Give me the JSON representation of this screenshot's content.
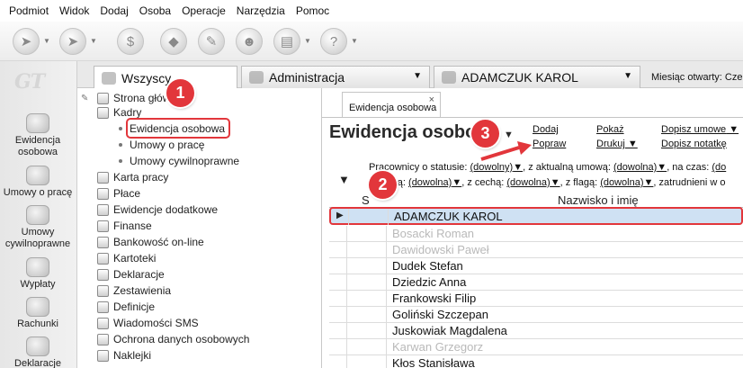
{
  "menu": [
    "Podmiot",
    "Widok",
    "Dodaj",
    "Osoba",
    "Operacje",
    "Narzędzia",
    "Pomoc"
  ],
  "logo": "GT",
  "sidebar": {
    "items": [
      {
        "label": "Ewidencja osobowa",
        "icon": "people-icon"
      },
      {
        "label": "Umowy o pracę",
        "icon": "contract-icon"
      },
      {
        "label": "Umowy cywilnoprawne",
        "icon": "money-icon"
      },
      {
        "label": "Wypłaty",
        "icon": "envelope-icon"
      },
      {
        "label": "Rachunki",
        "icon": "coins-icon"
      },
      {
        "label": "Deklaracje",
        "icon": "documents-icon"
      }
    ]
  },
  "top_tabs": [
    {
      "label": "Wszyscy",
      "active": true
    },
    {
      "label": "Administracja",
      "active": false
    },
    {
      "label": "ADAMCZUK KAROL",
      "active": false
    }
  ],
  "month_label": "Miesiąc otwarty: Cze",
  "tree": [
    {
      "label": "Strona główna",
      "level": 0
    },
    {
      "label": "Kadry",
      "level": 0
    },
    {
      "label": "Ewidencja osobowa",
      "level": 1,
      "highlighted": true
    },
    {
      "label": "Umowy o pracę",
      "level": 1
    },
    {
      "label": "Umowy cywilnoprawne",
      "level": 1
    },
    {
      "label": "Karta pracy",
      "level": 0
    },
    {
      "label": "Płace",
      "level": 0
    },
    {
      "label": "Ewidencje dodatkowe",
      "level": 0
    },
    {
      "label": "Finanse",
      "level": 0
    },
    {
      "label": "Bankowość on-line",
      "level": 0
    },
    {
      "label": "Kartoteki",
      "level": 0
    },
    {
      "label": "Deklaracje",
      "level": 0
    },
    {
      "label": "Zestawienia",
      "level": 0
    },
    {
      "label": "Definicje",
      "level": 0
    },
    {
      "label": "Wiadomości SMS",
      "level": 0
    },
    {
      "label": "Ochrona danych osobowych",
      "level": 0
    },
    {
      "label": "Naklejki",
      "level": 0
    }
  ],
  "content": {
    "tab_label": "Ewidencja osobowa",
    "tab_close": "×",
    "title": "Ewidencja osobowa",
    "actions": {
      "dodaj": "Dodaj",
      "popraw": "Popraw",
      "pokaz": "Pokaż",
      "drukuj": "Drukuj",
      "dopisz_umowe": "Dopisz umowe",
      "dopisz_notatke": "Dopisz notatkę"
    },
    "filters": {
      "row1_prefix": "Pracownicy o statusie:",
      "status_value": "(dowolny)",
      "umowa_label": ", z aktualną umową:",
      "umowa_value": "(dowolna)",
      "czas_label": ", na czas:",
      "czas_value": "(do",
      "row2_prefix": "z cechą:",
      "grupy_value": "(dowolna)",
      "cecha_label": ", z cechą:",
      "cecha_value": "(dowolna)",
      "flaga_label": ", z flagą:",
      "flaga_value": "(dowolna)",
      "zatrud_label": ", zatrudnieni w o"
    },
    "grid": {
      "col_s": "S",
      "col_name": "Nazwisko i imię",
      "rows": [
        {
          "name": "ADAMCZUK KAROL",
          "selected": true,
          "dim": false
        },
        {
          "name": "Bosacki Roman",
          "selected": false,
          "dim": true
        },
        {
          "name": "Dawidowski Paweł",
          "selected": false,
          "dim": true
        },
        {
          "name": "Dudek Stefan",
          "selected": false,
          "dim": false
        },
        {
          "name": "Dziedzic Anna",
          "selected": false,
          "dim": false
        },
        {
          "name": "Frankowski Filip",
          "selected": false,
          "dim": false
        },
        {
          "name": "Goliński Szczepan",
          "selected": false,
          "dim": false
        },
        {
          "name": "Juskowiak Magdalena",
          "selected": false,
          "dim": false
        },
        {
          "name": "Karwan Grzegorz",
          "selected": false,
          "dim": true
        },
        {
          "name": "Kłos Stanisława",
          "selected": false,
          "dim": false
        }
      ]
    }
  },
  "callouts": [
    "1",
    "2",
    "3"
  ],
  "colors": {
    "highlight": "#e2363b",
    "selection": "#cfe1f3"
  }
}
